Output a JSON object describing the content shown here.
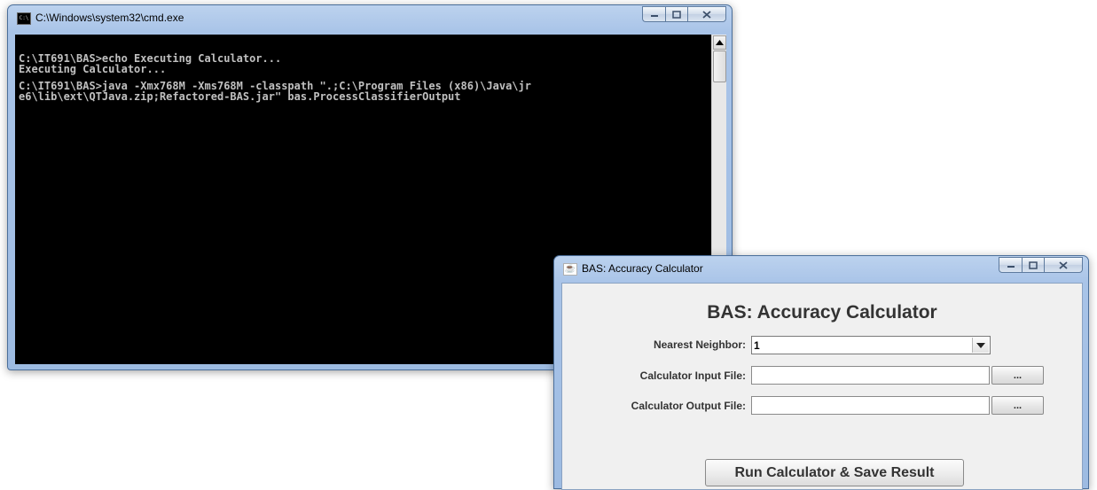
{
  "cmd_window": {
    "title": "C:\\Windows\\system32\\cmd.exe",
    "icon_label": "C:\\",
    "console_lines": [
      "C:\\IT691\\BAS>echo Executing Calculator...",
      "Executing Calculator...",
      "",
      "C:\\IT691\\BAS>java -Xmx768M -Xms768M -classpath \".;C:\\Program Files (x86)\\Java\\jr",
      "e6\\lib\\ext\\QTJava.zip;Refactored-BAS.jar\" bas.ProcessClassifierOutput"
    ]
  },
  "bas_window": {
    "title": "BAS: Accuracy Calculator",
    "heading": "BAS: Accuracy Calculator",
    "nearest_neighbor": {
      "label": "Nearest Neighbor:",
      "value": "1"
    },
    "input_file": {
      "label": "Calculator Input File:",
      "value": "",
      "browse_label": "..."
    },
    "output_file": {
      "label": "Calculator Output File:",
      "value": "",
      "browse_label": "..."
    },
    "run_button": "Run Calculator & Save Result"
  },
  "colors": {
    "console_bg": "#000000",
    "console_fg": "#c0c0c0",
    "dialog_bg": "#f0f0f0",
    "frame": "#a9c4e8"
  }
}
